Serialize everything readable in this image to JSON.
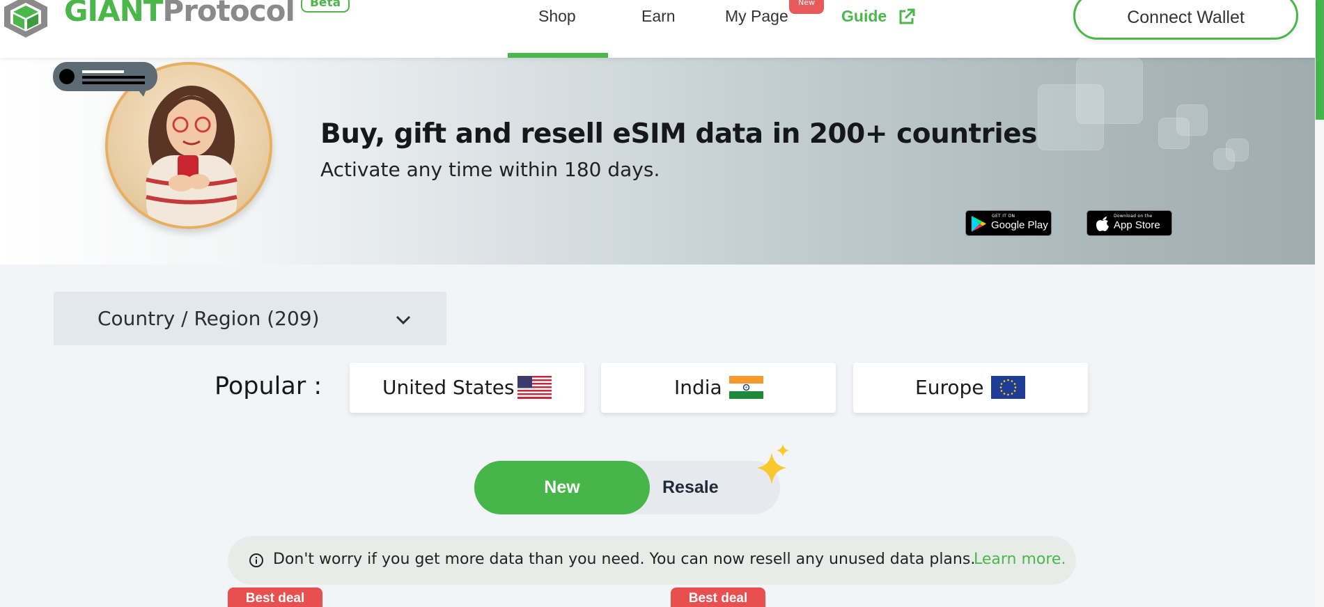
{
  "header": {
    "brand_primary": "GIANT",
    "brand_secondary": "Protocol",
    "beta_label": "Beta",
    "nav": {
      "shop": "Shop",
      "earn": "Earn",
      "my_page": "My Page",
      "my_page_badge": "New",
      "guide": "Guide"
    },
    "connect_wallet": "Connect Wallet"
  },
  "hero": {
    "title": "Buy, gift and resell eSIM data in 200+ countries",
    "subtitle": "Activate any time within 180 days.",
    "google_play": {
      "small": "GET IT ON",
      "big": "Google Play"
    },
    "app_store": {
      "small": "Download on the",
      "big": "App Store"
    }
  },
  "region": {
    "label": "Country / Region (209)"
  },
  "popular": {
    "label": "Popular :",
    "items": [
      {
        "name": "United States",
        "flag": "us-flag"
      },
      {
        "name": "India",
        "flag": "india-flag"
      },
      {
        "name": "Europe",
        "flag": "eu-flag"
      }
    ]
  },
  "toggle": {
    "new": "New",
    "resale": "Resale",
    "selected": "New"
  },
  "info": {
    "text": "Don't worry if you get more data than you need. You can now resell any unused data plans.",
    "link": "Learn more."
  },
  "deals": [
    "Best deal",
    "Best deal"
  ],
  "colors": {
    "brand_green": "#4bb64a",
    "badge_red": "#e85050",
    "hero_gradient_end": "#9fadb0"
  }
}
